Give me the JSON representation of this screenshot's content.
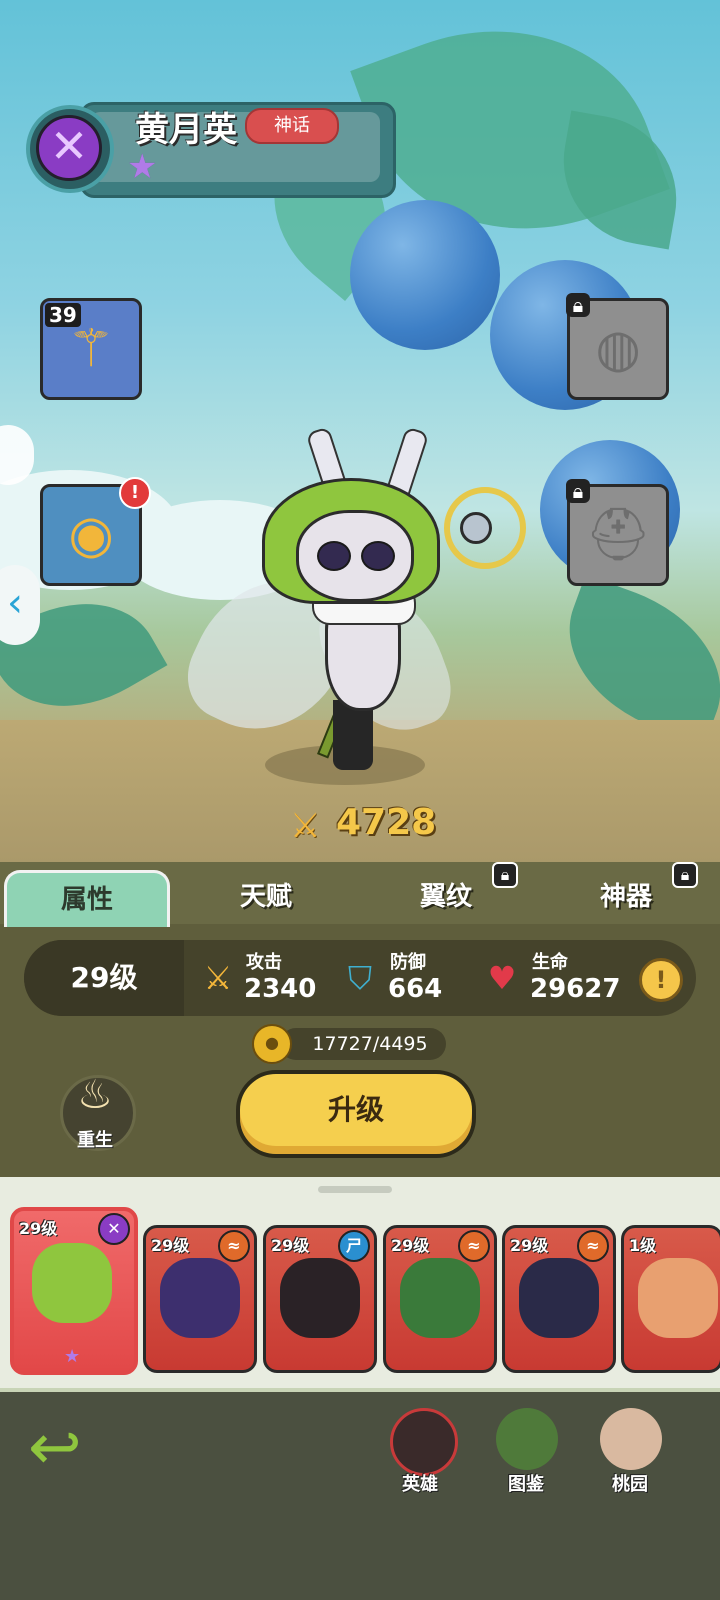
{
  "hero": {
    "name": "黄月英",
    "rarity": "神话",
    "stars": "★",
    "class_icon": "x-class-icon",
    "power_icon": "sword-power-icon",
    "power": "4728"
  },
  "equipment": {
    "slot1": {
      "level": "39",
      "icon": "golden-mace-icon"
    },
    "slot2": {
      "badge": "!",
      "icon": "golden-orb-icon"
    },
    "slot3": {
      "icon": "locked-bracelet-icon",
      "locked": true
    },
    "slot4": {
      "icon": "locked-helmet-icon",
      "locked": true
    }
  },
  "tabs": [
    {
      "label": "属性",
      "active": true
    },
    {
      "label": "天赋",
      "active": false
    },
    {
      "label": "翼纹",
      "locked": true
    },
    {
      "label": "神器",
      "locked": true
    }
  ],
  "stats": {
    "level": "29级",
    "attack_label": "攻击",
    "attack": "2340",
    "defense_label": "防御",
    "defense": "664",
    "hp_label": "生命",
    "hp": "29627",
    "info": "!"
  },
  "upgrade": {
    "cost": "17727/4495",
    "button_label": "升级",
    "rebirth_label": "重生"
  },
  "roster": [
    {
      "level": "29级",
      "faction": "✕",
      "faction_color": "#8a3cc4",
      "face_color": "#8fc63e",
      "selected": true,
      "star": "★"
    },
    {
      "level": "29级",
      "faction": "≈",
      "faction_color": "#e06a2a",
      "face_color": "#3d2f6e"
    },
    {
      "level": "29级",
      "faction": "ㄕ",
      "faction_color": "#2a8fd0",
      "face_color": "#2a2226"
    },
    {
      "level": "29级",
      "faction": "≈",
      "faction_color": "#e06a2a",
      "face_color": "#3a7a3a"
    },
    {
      "level": "29级",
      "faction": "≈",
      "faction_color": "#e06a2a",
      "face_color": "#2a2a48"
    },
    {
      "level": "1级",
      "faction": "",
      "faction_color": "#e06a2a",
      "face_color": "#e8a070"
    }
  ],
  "nav": {
    "back_icon": "back-arrow-icon",
    "heroes": "英雄",
    "codex": "图鉴",
    "garden": "桃园"
  },
  "colors": {
    "accent_gold": "#f5c84a",
    "tab_active": "#8fd3b4",
    "panel": "#5f5e3c",
    "rarity_red": "#d94f4f"
  }
}
